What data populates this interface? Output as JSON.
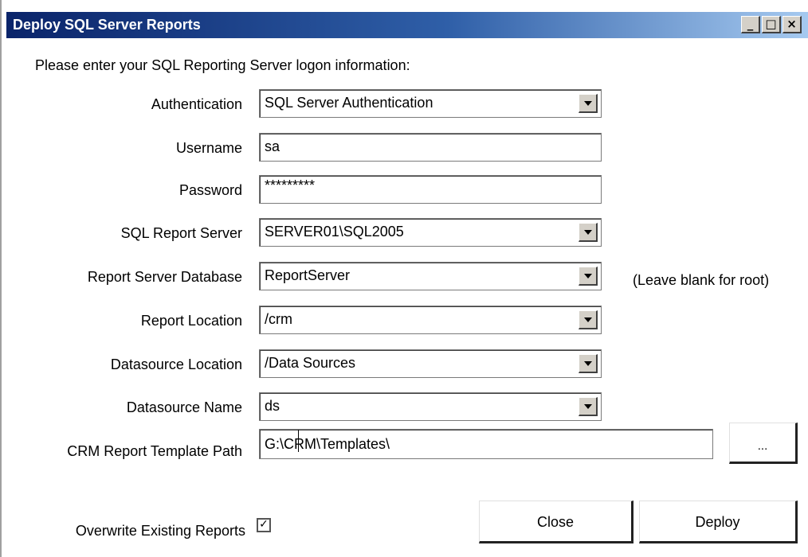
{
  "window": {
    "title": "Deploy SQL Server Reports",
    "controls": {
      "minimize": "_",
      "maximize": "□",
      "close": "×"
    }
  },
  "instruction": "Please enter your SQL Reporting Server logon information:",
  "fields": {
    "authentication": {
      "label": "Authentication",
      "value": "SQL Server Authentication"
    },
    "username": {
      "label": "Username",
      "value": "sa"
    },
    "password": {
      "label": "Password",
      "value": "*********"
    },
    "report_server": {
      "label": "SQL Report Server",
      "value": "SERVER01\\SQL2005"
    },
    "server_database": {
      "label": "Report Server Database",
      "value": "ReportServer",
      "note": "(Leave blank for root)"
    },
    "report_location": {
      "label": "Report Location",
      "value": "/crm"
    },
    "datasource_location": {
      "label": "Datasource Location",
      "value": "/Data Sources"
    },
    "datasource_name": {
      "label": "Datasource Name",
      "value": "ds"
    },
    "template_path": {
      "label": "CRM Report Template Path",
      "value": "G:\\CRM\\Templates\\",
      "browse_label": "..."
    }
  },
  "overwrite": {
    "label": "Overwrite Existing Reports",
    "checked": true,
    "check_glyph": "✓"
  },
  "buttons": {
    "close": "Close",
    "deploy": "Deploy"
  }
}
